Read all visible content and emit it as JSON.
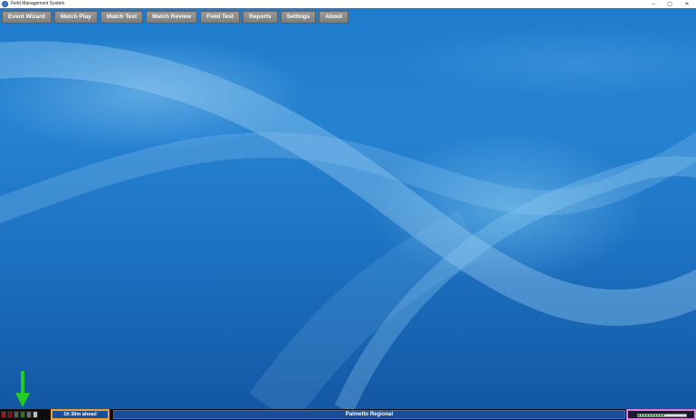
{
  "window": {
    "title": "Field Management System",
    "controls": {
      "minimize": "–",
      "maximize": "▢",
      "close": "✕"
    }
  },
  "menu": {
    "items": [
      {
        "label": "Event Wizard"
      },
      {
        "label": "Match Play"
      },
      {
        "label": "Match Test"
      },
      {
        "label": "Match Review"
      },
      {
        "label": "Field Test"
      },
      {
        "label": "Reports"
      },
      {
        "label": "Settings"
      },
      {
        "label": "About"
      }
    ]
  },
  "status": {
    "lights": [
      "#a01818",
      "#7a1020",
      "#5a5a5a",
      "#2f6f2f",
      "#6e6e6e",
      "#bdbdbd"
    ],
    "schedule": "1h 30m ahead",
    "event_name": "Palmetto Regional",
    "signal_level": 0.55
  },
  "colors": {
    "accent_orange": "#f0a030",
    "accent_pink": "#e07be0",
    "arrow_green": "#22cc22"
  }
}
